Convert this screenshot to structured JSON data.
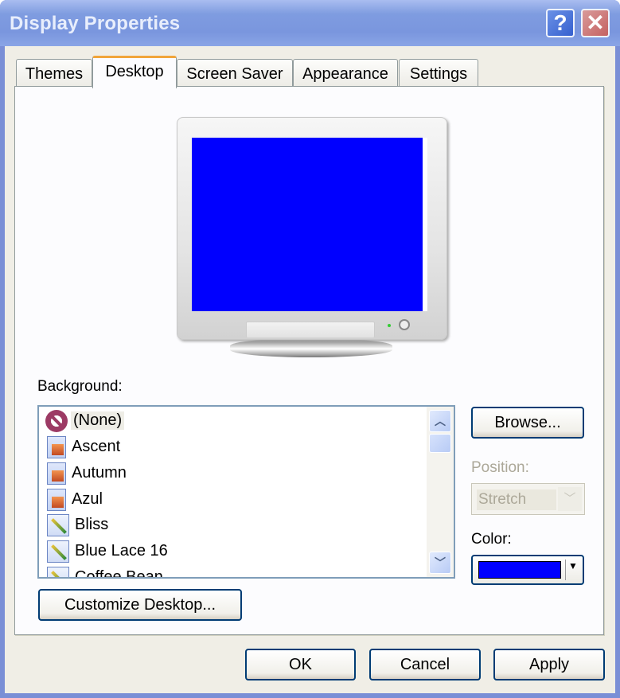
{
  "window": {
    "title": "Display Properties",
    "help_icon": "question-mark-icon",
    "close_icon": "close-x-icon",
    "help_glyph": "?",
    "close_glyph": "✕"
  },
  "tabs": [
    {
      "label": "Themes",
      "active": false
    },
    {
      "label": "Desktop",
      "active": true
    },
    {
      "label": "Screen Saver",
      "active": false
    },
    {
      "label": "Appearance",
      "active": false
    },
    {
      "label": "Settings",
      "active": false
    }
  ],
  "preview": {
    "screen_color": "#0000ff"
  },
  "background": {
    "label": "Background:",
    "items": [
      {
        "label": "(None)",
        "icon": "none-icon",
        "selected": true
      },
      {
        "label": "Ascent",
        "icon": "picture-file-icon",
        "selected": false
      },
      {
        "label": "Autumn",
        "icon": "picture-file-icon",
        "selected": false
      },
      {
        "label": "Azul",
        "icon": "picture-file-icon",
        "selected": false
      },
      {
        "label": "Bliss",
        "icon": "image-file-icon",
        "selected": false
      },
      {
        "label": "Blue Lace 16",
        "icon": "image-file-icon",
        "selected": false
      },
      {
        "label": "Coffee Bean",
        "icon": "image-file-icon",
        "selected": false
      }
    ],
    "scroll_up_glyph": "︿",
    "scroll_down_glyph": "﹀"
  },
  "browse_label": "Browse...",
  "position": {
    "label": "Position:",
    "value": "Stretch",
    "enabled": false,
    "dropdown_glyph": "﹀"
  },
  "color": {
    "label": "Color:",
    "value": "#0000ff",
    "dropdown_glyph": "▼"
  },
  "customize_label": "Customize Desktop...",
  "footer": {
    "ok": "OK",
    "cancel": "Cancel",
    "apply": "Apply"
  }
}
